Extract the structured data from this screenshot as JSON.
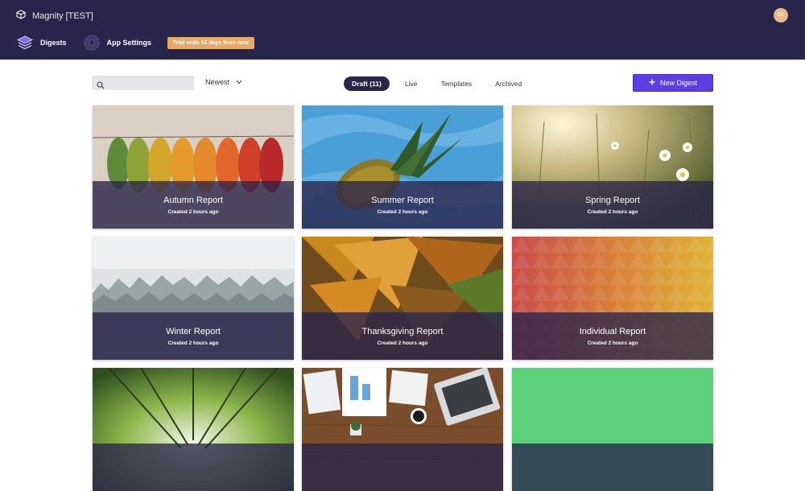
{
  "app": {
    "title": "Magnity [TEST]",
    "avatar_initials": "EK"
  },
  "nav": {
    "digests_label": "Digests",
    "settings_label": "App Settings",
    "trial_badge": "Trial ends 12 days from now"
  },
  "toolbar": {
    "search_placeholder": "",
    "sort_label": "Newest",
    "tabs": [
      "Draft (11)",
      "Live",
      "Templates",
      "Archived"
    ],
    "active_tab": "Draft (11)",
    "new_button_label": "New Digest"
  },
  "cards": [
    {
      "title": "Autumn Report",
      "subtitle": "Created 2 hours ago",
      "image": "autumn-leaves"
    },
    {
      "title": "Summer Report",
      "subtitle": "Created 2 hours ago",
      "image": "pineapple-water"
    },
    {
      "title": "Spring Report",
      "subtitle": "Created 2 hours ago",
      "image": "daisies-field"
    },
    {
      "title": "Winter Report",
      "subtitle": "Created 2 hours ago",
      "image": "foggy-forest"
    },
    {
      "title": "Thanksgiving Report",
      "subtitle": "Created 2 hours ago",
      "image": "fall-leaves"
    },
    {
      "title": "Individual Report",
      "subtitle": "Created 2 hours ago",
      "image": "geometric-pattern"
    },
    {
      "title": "",
      "subtitle": "",
      "image": "bamboo-canopy"
    },
    {
      "title": "",
      "subtitle": "",
      "image": "desk-laptop"
    },
    {
      "title": "",
      "subtitle": "",
      "image": "solid-green"
    }
  ],
  "colors": {
    "header_bg": "#29244a",
    "accent": "#5b3fe0",
    "trial": "#e8a866",
    "overlay": "#29244a"
  }
}
